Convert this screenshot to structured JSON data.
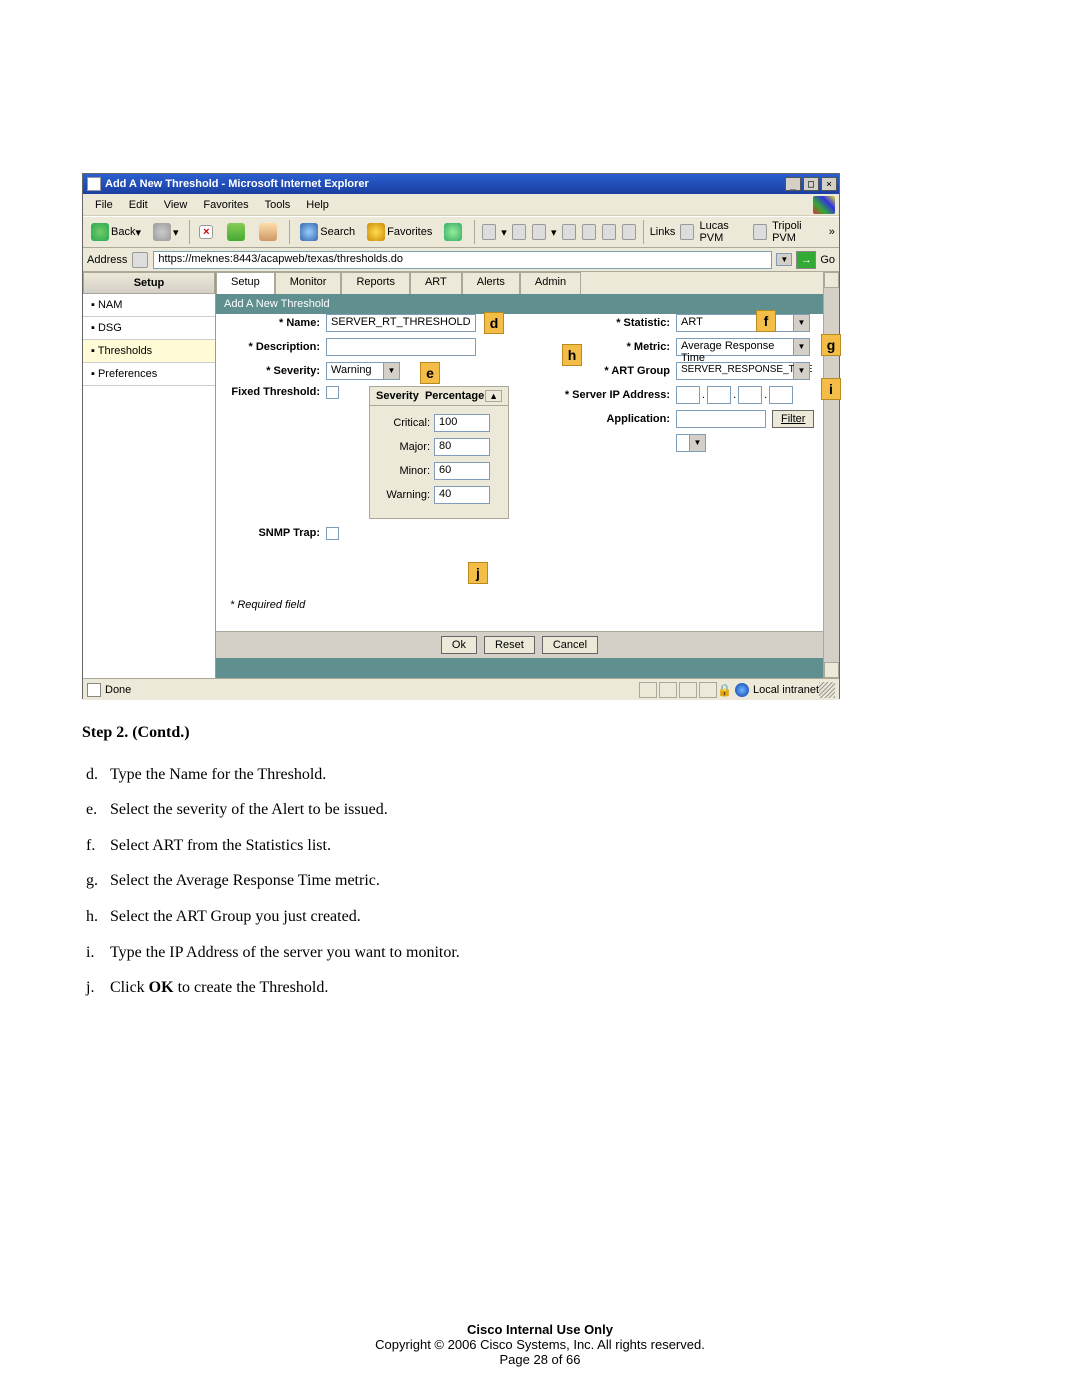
{
  "window": {
    "title": "Add A New Threshold - Microsoft Internet Explorer"
  },
  "menu": {
    "file": "File",
    "edit": "Edit",
    "view": "View",
    "favorites": "Favorites",
    "tools": "Tools",
    "help": "Help"
  },
  "toolbar": {
    "back": "Back",
    "search": "Search",
    "favorites": "Favorites",
    "links_label": "Links",
    "link1": "Lucas PVM",
    "link2": "Tripoli PVM"
  },
  "address": {
    "label": "Address",
    "url": "https://meknes:8443/acapweb/texas/thresholds.do",
    "go": "Go"
  },
  "left_nav": {
    "header": "Setup",
    "items": [
      "NAM",
      "DSG",
      "Thresholds",
      "Preferences"
    ]
  },
  "tabs": [
    "Setup",
    "Monitor",
    "Reports",
    "ART",
    "Alerts",
    "Admin"
  ],
  "subheader": "Add A New Threshold",
  "form": {
    "name_label": "* Name:",
    "name_value": "SERVER_RT_THRESHOLD",
    "description_label": "* Description:",
    "description_value": "",
    "severity_label": "* Severity:",
    "severity_value": "Warning",
    "fixed_threshold_label": "Fixed Threshold:",
    "sev_header_severity": "Severity",
    "sev_header_percentage": "Percentage",
    "critical_label": "Critical:",
    "critical_value": "100",
    "major_label": "Major:",
    "major_value": "80",
    "minor_label": "Minor:",
    "minor_value": "60",
    "warning_label": "Warning:",
    "warning_value": "40",
    "snmp_trap_label": "SNMP Trap:",
    "required_note": "* Required field",
    "statistic_label": "* Statistic:",
    "statistic_value": "ART",
    "metric_label": "* Metric:",
    "metric_value": "Average Response Time",
    "art_group_label": "* ART Group",
    "art_group_value": "SERVER_RESPONSE_TIME",
    "server_ip_label": "* Server IP Address:",
    "application_label": "Application:",
    "application_value": "",
    "filter_label": "Filter"
  },
  "buttons": {
    "ok": "Ok",
    "reset": "Reset",
    "cancel": "Cancel"
  },
  "status": {
    "done": "Done",
    "zone": "Local intranet"
  },
  "callouts": {
    "d": "d",
    "e": "e",
    "f": "f",
    "g": "g",
    "h": "h",
    "i": "i",
    "j": "j"
  },
  "doc": {
    "step_heading": "Step 2. (Contd.)",
    "items": [
      {
        "letter": "d.",
        "text": "Type the Name for the Threshold."
      },
      {
        "letter": "e.",
        "text": "Select the severity of the Alert to be issued."
      },
      {
        "letter": "f.",
        "text": "Select ART from the Statistics list."
      },
      {
        "letter": "g.",
        "text": "Select the Average Response Time metric."
      },
      {
        "letter": "h.",
        "text": "Select the ART Group you just created."
      },
      {
        "letter": "i.",
        "text": "Type the IP Address of the server you want to monitor."
      },
      {
        "letter": "j.",
        "text_before": "Click ",
        "bold": "OK",
        "text_after": " to create the Threshold."
      }
    ]
  },
  "footer": {
    "line1": "Cisco Internal Use Only",
    "line2": "Copyright © 2006 Cisco Systems, Inc. All rights reserved.",
    "line3": "Page 28 of 66"
  }
}
